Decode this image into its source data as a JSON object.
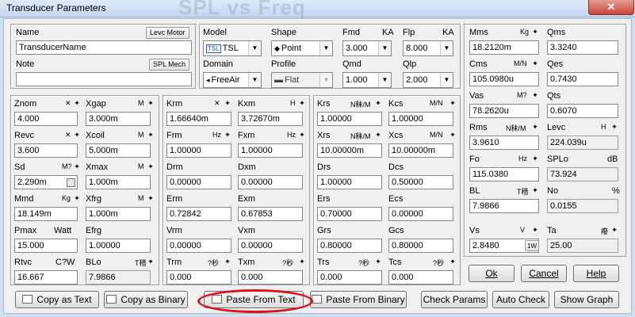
{
  "window": {
    "title": "Transducer Parameters",
    "background_title": "SPL vs Freq",
    "close": "✕"
  },
  "top": {
    "name_label": "Name",
    "levc_motor_btn": "Levc Motor",
    "name_value": "TransducerName",
    "note_label": "Note",
    "spl_mech_btn": "SPL Mech",
    "note_value": "",
    "model_label": "Model",
    "model_value": "TSL",
    "model_icon": "TSL",
    "shape_label": "Shape",
    "shape_value": "Point",
    "domain_label": "Domain",
    "domain_value": "FreeAir",
    "profile_label": "Profile",
    "profile_value": "Flat",
    "fmd_label": "Fmd",
    "fmd_unit": "KA",
    "fmd_value": "3.000",
    "flp_label": "Flp",
    "flp_unit": "KA",
    "flp_value": "8.000",
    "qmd_label": "Qmd",
    "qmd_value": "1.000",
    "qlp_label": "Qlp",
    "qlp_value": "2.000"
  },
  "left": {
    "znom": {
      "label": "Znom",
      "unit": "✕",
      "value": "4.000"
    },
    "xgap": {
      "label": "Xgap",
      "unit": "M",
      "value": "3.000m"
    },
    "revc": {
      "label": "Revc",
      "unit": "✕",
      "value": "3.600"
    },
    "xcoil": {
      "label": "Xcoil",
      "unit": "M",
      "value": "5.000m"
    },
    "sd": {
      "label": "Sd",
      "unit": "M?",
      "value": "2.290m"
    },
    "xmax": {
      "label": "Xmax",
      "unit": "M",
      "value": "1.000m"
    },
    "mmd": {
      "label": "Mmd",
      "unit": "Kg",
      "value": "18.149m"
    },
    "xfrg": {
      "label": "Xfrg",
      "unit": "M",
      "value": "1.000m"
    },
    "pmax": {
      "label": "Pmax",
      "unit": "Watt",
      "value": "15.000"
    },
    "efrg": {
      "label": "Efrg",
      "value": "1.00000"
    },
    "rtvc": {
      "label": "Rtvc",
      "unit": "C?W",
      "value": "16.667"
    },
    "blo": {
      "label": "BLo",
      "unit": "T稓",
      "value": "7.9866"
    }
  },
  "mid": {
    "krm": {
      "label": "Krm",
      "unit": "✕",
      "value": "1.66640m"
    },
    "kxm": {
      "label": "Kxm",
      "unit": "H",
      "value": "3.72670m"
    },
    "frm": {
      "label": "Frm",
      "unit": "Hz",
      "value": "1.00000"
    },
    "fxm": {
      "label": "Fxm",
      "unit": "Hz",
      "value": "1.00000"
    },
    "drm": {
      "label": "Drm",
      "value": "0.00000"
    },
    "dxm": {
      "label": "Dxm",
      "value": "0.00000"
    },
    "erm": {
      "label": "Erm",
      "value": "0.72842"
    },
    "exm": {
      "label": "Exm",
      "value": "0.67853"
    },
    "vrm": {
      "label": "Vrm",
      "value": "0.00000"
    },
    "vxm": {
      "label": "Vxm",
      "value": "0.00000"
    },
    "trm": {
      "label": "Trm",
      "unit": "?秒",
      "value": "0.000"
    },
    "txm": {
      "label": "Txm",
      "unit": "?秒",
      "value": "0.000"
    }
  },
  "right_mid": {
    "krs": {
      "label": "Krs",
      "unit": "N秣/M",
      "value": "1.00000"
    },
    "kcs": {
      "label": "Kcs",
      "unit": "M/N",
      "value": "1.00000"
    },
    "xrs": {
      "label": "Xrs",
      "unit": "N秣/M",
      "value": "10.00000m"
    },
    "xcs": {
      "label": "Xcs",
      "unit": "M/N",
      "value": "10.00000m"
    },
    "drs": {
      "label": "Drs",
      "value": "1.00000"
    },
    "dcs": {
      "label": "Dcs",
      "value": "0.50000"
    },
    "ers": {
      "label": "Ers",
      "value": "0.70000"
    },
    "ecs": {
      "label": "Ecs",
      "value": "0.00000"
    },
    "grs": {
      "label": "Grs",
      "value": "0.80000"
    },
    "gcs": {
      "label": "Gcs",
      "value": "0.80000"
    },
    "trs": {
      "label": "Trs",
      "unit": "?秒",
      "value": "0.000"
    },
    "tcs": {
      "label": "Tcs",
      "unit": "?秒",
      "value": "0.000"
    }
  },
  "right": {
    "mms": {
      "label": "Mms",
      "unit": "Kg",
      "value": "18.2120m"
    },
    "qms": {
      "label": "Qms",
      "value": "3.3240"
    },
    "cms": {
      "label": "Cms",
      "unit": "M/N",
      "value": "105.0980u"
    },
    "qes": {
      "label": "Qes",
      "value": "0.7430"
    },
    "vas": {
      "label": "Vas",
      "unit": "M?",
      "value": "78.2620u"
    },
    "qts": {
      "label": "Qts",
      "value": "0.6070"
    },
    "rms": {
      "label": "Rms",
      "unit": "N秣/M",
      "value": "3.9610"
    },
    "levc": {
      "label": "Levc",
      "unit": "H",
      "value": "224.039u"
    },
    "fo": {
      "label": "Fo",
      "unit": "Hz",
      "value": "115.0380"
    },
    "splo": {
      "label": "SPLo",
      "unit": "dB",
      "value": "73.924"
    },
    "bl": {
      "label": "BL",
      "unit": "T稓",
      "value": "7.9866"
    },
    "no": {
      "label": "No",
      "unit": "%",
      "value": "0.0155"
    },
    "vs": {
      "label": "Vs",
      "unit": "V",
      "value": "2.8480",
      "btn": "1W"
    },
    "ta": {
      "label": "Ta",
      "unit": "癈",
      "value": "25.00"
    }
  },
  "buttons": {
    "ok": "Ok",
    "cancel": "Cancel",
    "help": "Help",
    "copy_text": "Copy as Text",
    "copy_binary": "Copy as Binary",
    "paste_text": "Paste From Text",
    "paste_binary": "Paste From Binary",
    "check_params": "Check Params",
    "auto_check": "Auto Check",
    "show_graph": "Show Graph"
  },
  "colors": {
    "highlight_oval": "#e0101a",
    "window_frame": "#cfe0f3"
  }
}
